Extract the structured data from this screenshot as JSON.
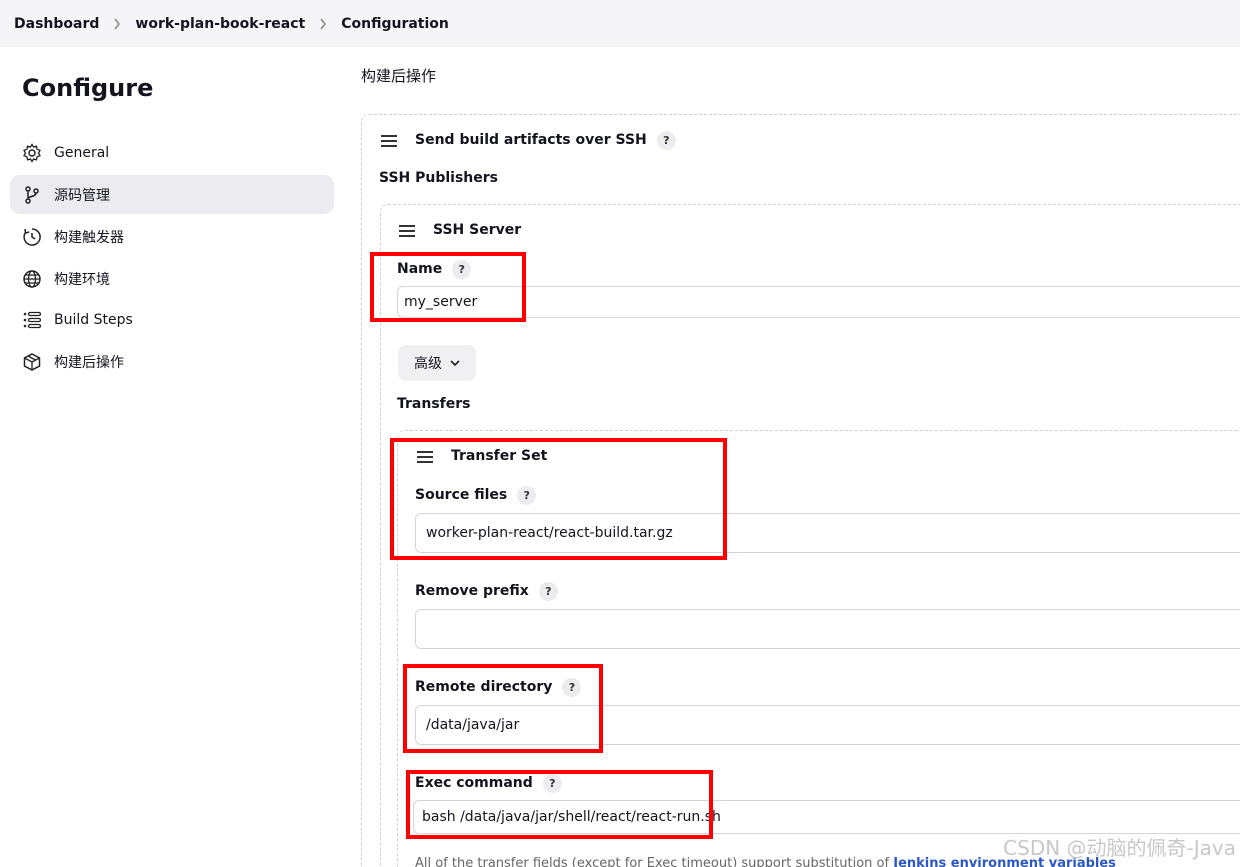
{
  "breadcrumb": {
    "items": [
      "Dashboard",
      "work-plan-book-react",
      "Configuration"
    ]
  },
  "sidebar": {
    "title": "Configure",
    "items": [
      {
        "label": "General",
        "icon": "gear-icon"
      },
      {
        "label": "源码管理",
        "icon": "branch-icon"
      },
      {
        "label": "构建触发器",
        "icon": "clock-icon"
      },
      {
        "label": "构建环境",
        "icon": "globe-icon"
      },
      {
        "label": "Build Steps",
        "icon": "list-icon"
      },
      {
        "label": "构建后操作",
        "icon": "package-icon"
      }
    ],
    "active_index": 1
  },
  "main": {
    "section_title": "构建后操作",
    "publisher": {
      "title": "Send build artifacts over SSH",
      "help": "?",
      "publishers_label": "SSH Publishers",
      "server": {
        "title": "SSH Server",
        "name_label": "Name",
        "name_help": "?",
        "name_value": "my_server",
        "advanced_label": "高级",
        "transfers_label": "Transfers",
        "transfer_set": {
          "title": "Transfer Set",
          "source_label": "Source files",
          "source_help": "?",
          "source_value": "worker-plan-react/react-build.tar.gz",
          "remove_prefix_label": "Remove prefix",
          "remove_prefix_help": "?",
          "remove_prefix_value": "",
          "remote_dir_label": "Remote directory",
          "remote_dir_help": "?",
          "remote_dir_value": "/data/java/jar",
          "exec_label": "Exec command",
          "exec_help": "?",
          "exec_value": "bash /data/java/jar/shell/react/react-run.sh",
          "footnote_text": "All of the transfer fields (except for Exec timeout) support substitution of",
          "footnote_link": "Jenkins environment variables"
        }
      }
    }
  },
  "watermark": "CSDN @动脑的佩奇-Java",
  "colors": {
    "highlight": "#ff0000",
    "link": "#2c58c5",
    "active_bg": "#ececf0"
  }
}
